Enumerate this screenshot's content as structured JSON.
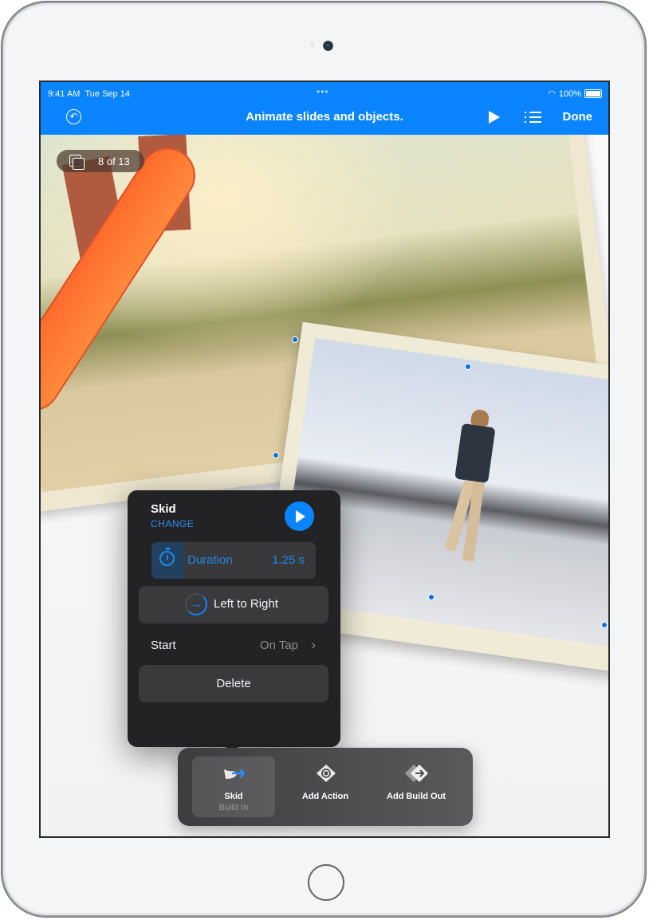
{
  "status_bar": {
    "time": "9:41 AM",
    "date": "Tue Sep 14",
    "multitask_dots": "•••",
    "wifi_icon": "wifi-icon",
    "battery": "100%"
  },
  "toolbar_top": {
    "undo_icon": "undo-icon",
    "title": "Animate slides and objects.",
    "play_icon": "play-icon",
    "list_icon": "list-icon",
    "done_label": "Done",
    "accent_color": "#0a84ff"
  },
  "slide": {
    "counter_icon": "slides-icon",
    "counter_text": "8 of 13"
  },
  "animation_popover": {
    "effect_name": "Skid",
    "change_label": "CHANGE",
    "preview_icon": "play-icon",
    "duration_label": "Duration",
    "duration_value": "1.25 s",
    "duration_fraction": 0.2,
    "direction_icon": "arrow-right-icon",
    "direction_label": "Left to Right",
    "start_label": "Start",
    "start_value": "On Tap",
    "delete_label": "Delete"
  },
  "animation_toolbar": {
    "items": [
      {
        "icon": "skid-build-in-icon",
        "label": "Skid",
        "sublabel": "Build In",
        "selected": true
      },
      {
        "icon": "add-action-icon",
        "label": "Add Action",
        "sublabel": "",
        "selected": false
      },
      {
        "icon": "add-build-out-icon",
        "label": "Add Build Out",
        "sublabel": "",
        "selected": false
      }
    ]
  }
}
